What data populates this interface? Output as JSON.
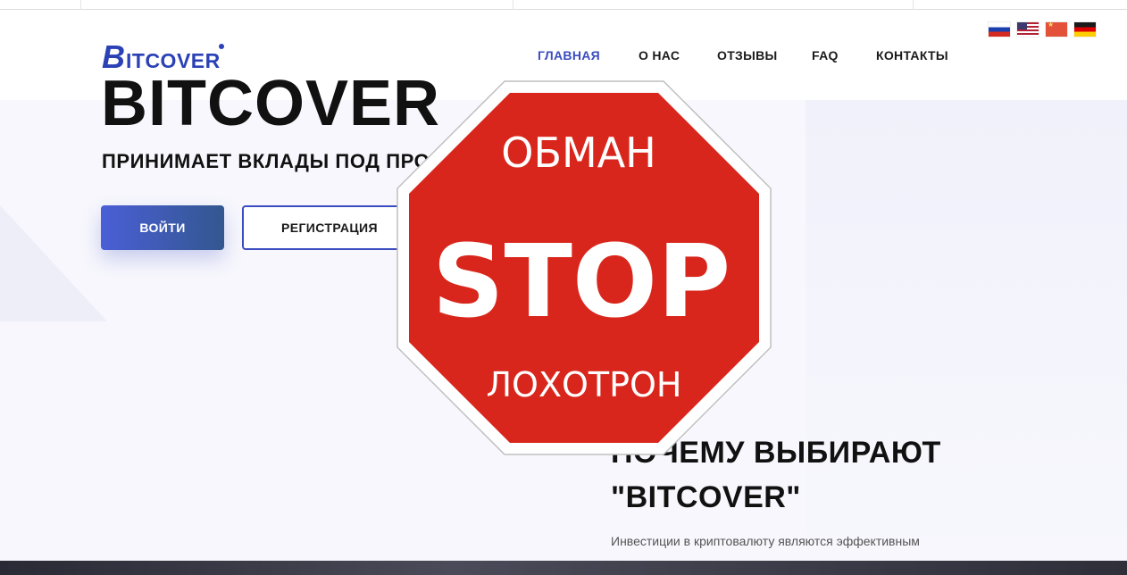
{
  "header": {
    "logo_initial": "B",
    "logo_rest": "ITCOVER",
    "nav": [
      "ГЛАВНАЯ",
      "О НАС",
      "ОТЗЫВЫ",
      "FAQ",
      "КОНТАКТЫ"
    ],
    "active_nav": "ГЛАВНАЯ",
    "languages": [
      "ru-flag-icon",
      "us-flag-icon",
      "cn-flag-icon",
      "de-flag-icon"
    ]
  },
  "hero": {
    "title": "BITCOVER",
    "subtitle": "ПРИНИМАЕТ ВКЛАДЫ ПОД ПРО",
    "login_label": "ВОЙТИ",
    "register_label": "РЕГИСТРАЦИЯ"
  },
  "why": {
    "title_line1": "ПОЧЕМУ ВЫБИРАЮТ",
    "title_line2": "\"BITCOVER\"",
    "text": "Инвестиции в криптовалюту являются эффективным"
  },
  "stop_sign": {
    "top": "ОБМАН",
    "middle": "STOP",
    "bottom": "ЛОХОТРОН",
    "color": "#d9261c"
  },
  "colors": {
    "accent": "#3b4cc0",
    "logo": "#2b41b5"
  }
}
